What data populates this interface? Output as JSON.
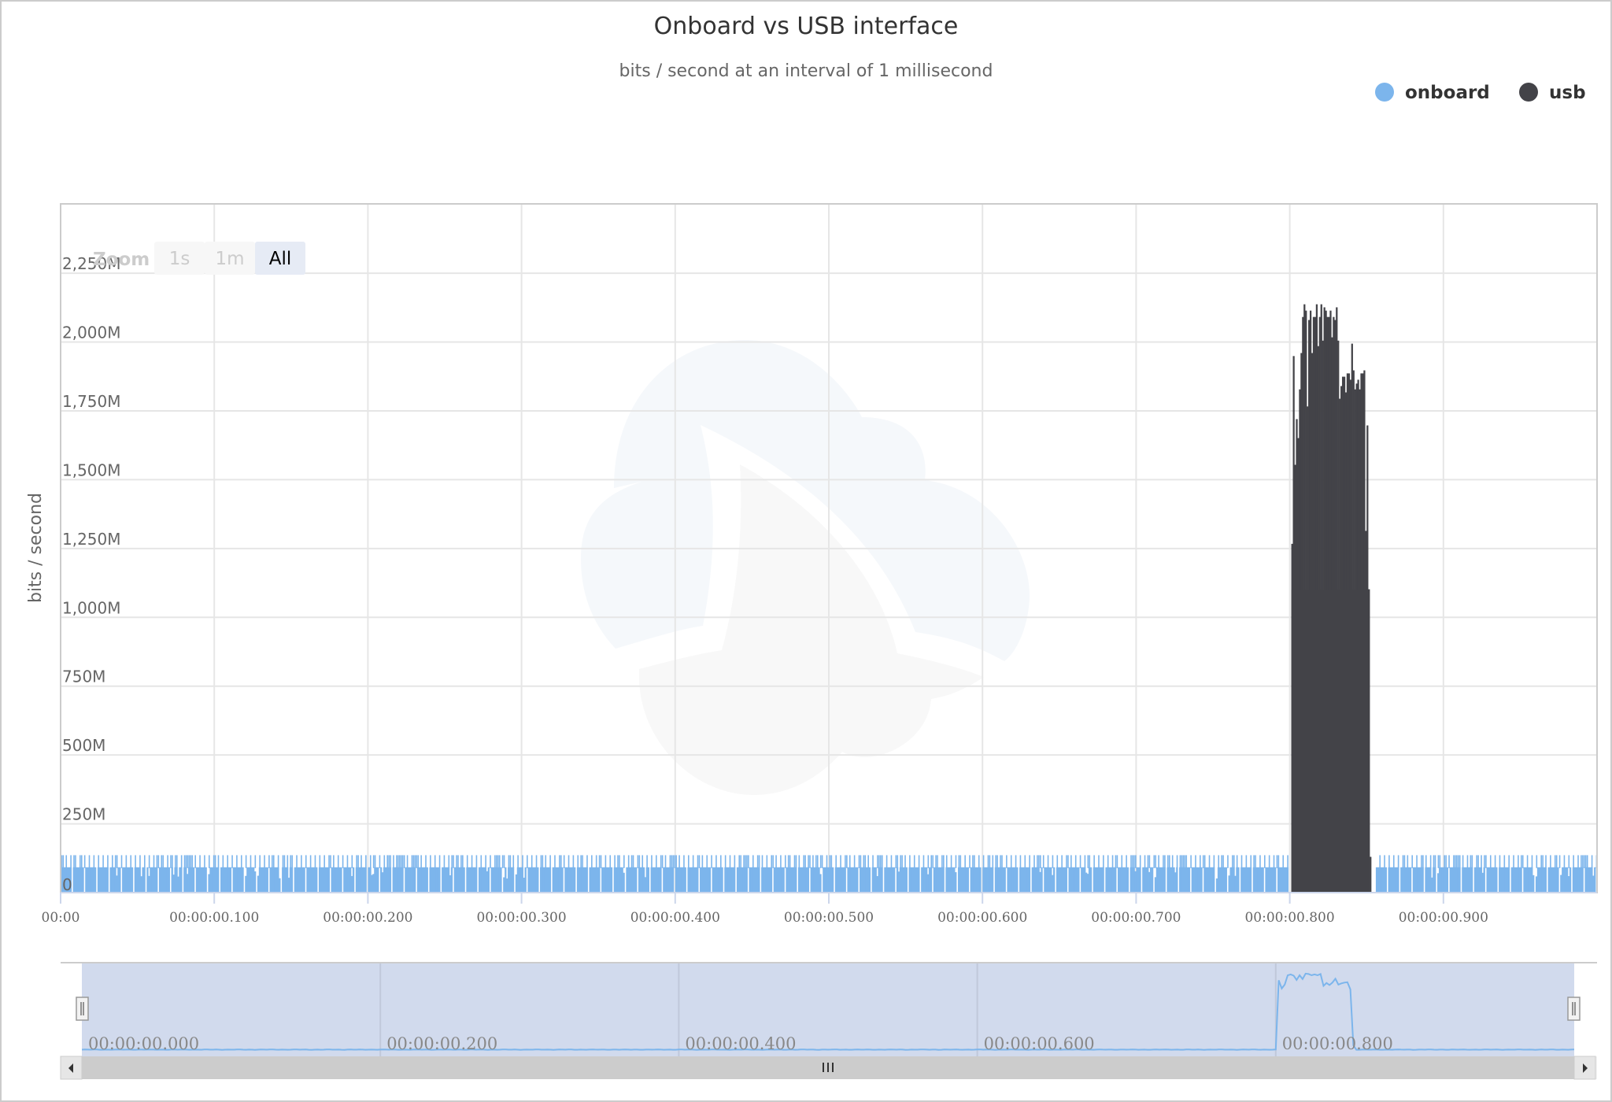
{
  "chart_data": {
    "type": "bar",
    "title": "Onboard vs USB interface",
    "subtitle": "bits / second at an interval of 1 millisecond",
    "xlabel": "",
    "ylabel": "bits / second",
    "x_unit": "seconds",
    "xlim": [
      0,
      1.0
    ],
    "ylim": [
      0,
      2500
    ],
    "y_unit": "M bits/second",
    "grid": true,
    "legend_position": "top-right",
    "y_ticks": [
      {
        "value": 0,
        "label": "0"
      },
      {
        "value": 250,
        "label": "250M"
      },
      {
        "value": 500,
        "label": "500M"
      },
      {
        "value": 750,
        "label": "750M"
      },
      {
        "value": 1000,
        "label": "1,000M"
      },
      {
        "value": 1250,
        "label": "1,250M"
      },
      {
        "value": 1500,
        "label": "1,500M"
      },
      {
        "value": 1750,
        "label": "1,750M"
      },
      {
        "value": 2000,
        "label": "2,000M"
      },
      {
        "value": 2250,
        "label": "2,250M"
      }
    ],
    "x_ticks": [
      {
        "value": 0.0,
        "label": "00:00"
      },
      {
        "value": 0.1,
        "label": "00:00:00.100"
      },
      {
        "value": 0.2,
        "label": "00:00:00.200"
      },
      {
        "value": 0.3,
        "label": "00:00:00.300"
      },
      {
        "value": 0.4,
        "label": "00:00:00.400"
      },
      {
        "value": 0.5,
        "label": "00:00:00.500"
      },
      {
        "value": 0.6,
        "label": "00:00:00.600"
      },
      {
        "value": 0.7,
        "label": "00:00:00.700"
      },
      {
        "value": 0.8,
        "label": "00:00:00.800"
      },
      {
        "value": 0.9,
        "label": "00:00:00.900"
      }
    ],
    "series": [
      {
        "name": "onboard",
        "color": "#7cb5ec",
        "description": "Periodic traffic ~92M bits/s baseline blocks with short spikes to ~136M bits/s, present across 0–1.0 s except during the usb burst",
        "baseline_value": 92,
        "spike_value": 136,
        "gap_range": [
          0.8,
          0.856
        ]
      },
      {
        "name": "usb",
        "color": "#434348",
        "start": 0.801,
        "interval": 0.001,
        "values": [
          1267,
          1949,
          1554,
          1720,
          1651,
          1828,
          1960,
          2091,
          2137,
          2114,
          1766,
          2080,
          2114,
          1960,
          2091,
          2091,
          2137,
          1985,
          2091,
          2137,
          2005,
          2126,
          2114,
          2091,
          2091,
          2114,
          2017,
          2091,
          2080,
          2126,
          2005,
          1794,
          1840,
          1874,
          1874,
          1817,
          1886,
          1886,
          1863,
          1994,
          1897,
          1828,
          1849,
          1863,
          1828,
          1886,
          1886,
          1897,
          1314,
          1697,
          1102,
          130
        ]
      }
    ]
  },
  "legend": {
    "items": [
      {
        "label": "onboard",
        "color": "#7cb5ec"
      },
      {
        "label": "usb",
        "color": "#434348"
      }
    ]
  },
  "range_selector": {
    "zoom_label": "Zoom",
    "buttons": [
      {
        "label": "1s",
        "state": "disabled"
      },
      {
        "label": "1m",
        "state": "disabled"
      },
      {
        "label": "All",
        "state": "selected"
      }
    ]
  },
  "navigator": {
    "labels": [
      "00:00:00.000",
      "00:00:00.200",
      "00:00:00.400",
      "00:00:00.600",
      "00:00:00.800"
    ],
    "selected_range": [
      0.0,
      1.0
    ]
  },
  "scrollbar": {
    "left_arrow": "◀",
    "right_arrow": "▶",
    "grip": "III"
  }
}
